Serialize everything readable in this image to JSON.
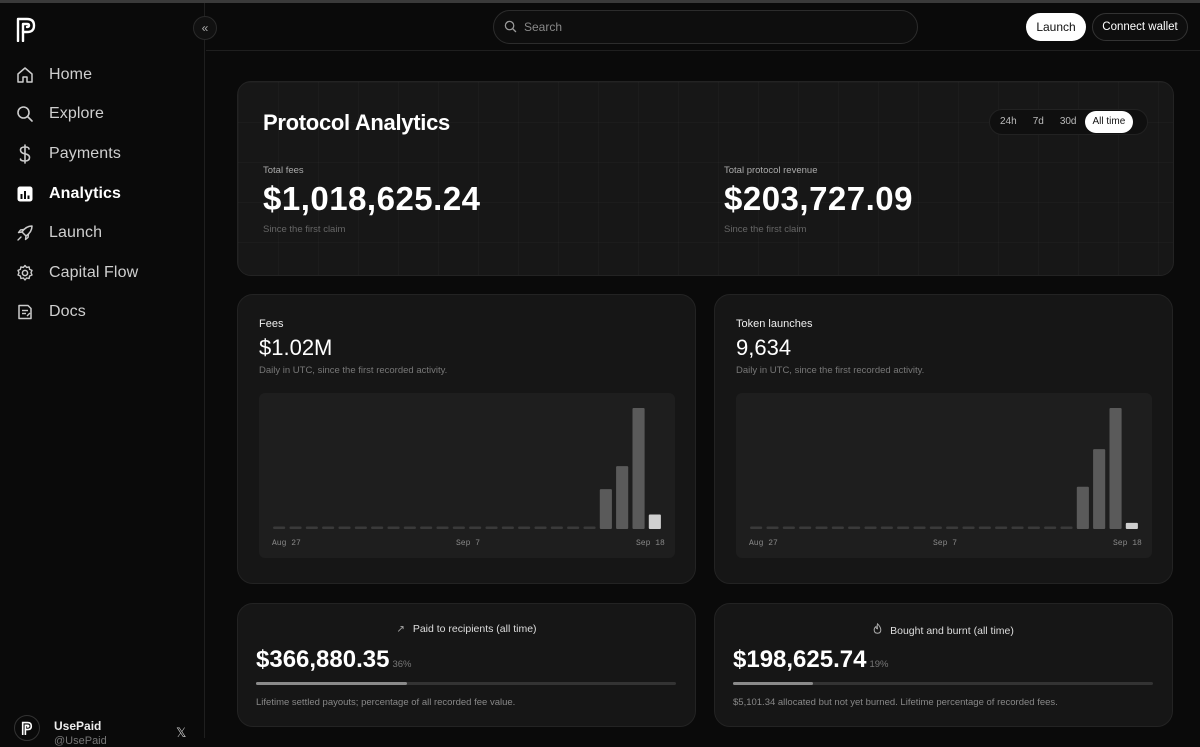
{
  "brand": {
    "name": "UsePaid",
    "handle": "@UsePaid"
  },
  "sidebar": {
    "items": [
      {
        "label": "Home",
        "icon": "home-icon",
        "active": false
      },
      {
        "label": "Explore",
        "icon": "search-icon",
        "active": false
      },
      {
        "label": "Payments",
        "icon": "dollar-icon",
        "active": false
      },
      {
        "label": "Analytics",
        "icon": "bar-chart-icon",
        "active": true
      },
      {
        "label": "Launch",
        "icon": "rocket-icon",
        "active": false
      },
      {
        "label": "Capital Flow",
        "icon": "gear-icon",
        "active": false
      },
      {
        "label": "Docs",
        "icon": "document-icon",
        "active": false
      }
    ]
  },
  "header": {
    "search_placeholder": "Search",
    "launch_label": "Launch",
    "wallet_label": "Connect wallet"
  },
  "analytics": {
    "title": "Protocol Analytics",
    "ranges": [
      "24h",
      "7d",
      "30d",
      "All time"
    ],
    "selected_range": "All time",
    "total_fees": {
      "label": "Total fees",
      "value": "$1,018,625.24",
      "note": "Since the first claim"
    },
    "total_revenue": {
      "label": "Total protocol revenue",
      "value": "$203,727.09",
      "note": "Since the first claim"
    }
  },
  "charts": {
    "fees": {
      "label": "Fees",
      "value": "$1.02M",
      "sub": "Daily in UTC, since the first recorded activity."
    },
    "launches": {
      "label": "Token launches",
      "value": "9,634",
      "sub": "Daily in UTC, since the first recorded activity."
    }
  },
  "chart_data": [
    {
      "type": "bar",
      "title": "Fees",
      "x_ticks": [
        "Aug 27",
        "Sep 7",
        "Sep 18"
      ],
      "values": [
        0.005,
        0.005,
        0.005,
        0.005,
        0.005,
        0.005,
        0.005,
        0.005,
        0.005,
        0.005,
        0.005,
        0.005,
        0.005,
        0.005,
        0.005,
        0.005,
        0.005,
        0.005,
        0.005,
        0.005,
        0.33,
        0.52,
        1.0,
        0.12
      ],
      "ylim": [
        0,
        1
      ]
    },
    {
      "type": "bar",
      "title": "Token launches",
      "x_ticks": [
        "Aug 27",
        "Sep 7",
        "Sep 18"
      ],
      "values": [
        0.005,
        0.005,
        0.005,
        0.005,
        0.005,
        0.005,
        0.005,
        0.005,
        0.005,
        0.005,
        0.005,
        0.005,
        0.005,
        0.005,
        0.005,
        0.005,
        0.005,
        0.005,
        0.005,
        0.005,
        0.35,
        0.66,
        1.0,
        0.05
      ],
      "ylim": [
        0,
        1
      ]
    }
  ],
  "summary": {
    "paid": {
      "title": "Paid to recipients (all time)",
      "value": "$366,880.35",
      "pct": "36%",
      "fraction": 0.36,
      "note": "Lifetime settled payouts; percentage of all recorded fee value."
    },
    "burnt": {
      "title": "Bought and burnt (all time)",
      "value": "$198,625.74",
      "pct": "19%",
      "fraction": 0.19,
      "note": "$5,101.34 allocated but not yet burned. Lifetime percentage of recorded fees."
    }
  },
  "colors": {
    "bar": "#5a5a5a",
    "bar_last": "#cfcfcf",
    "bar_flat": "#3a3a3a",
    "accent": "#ffffff"
  }
}
